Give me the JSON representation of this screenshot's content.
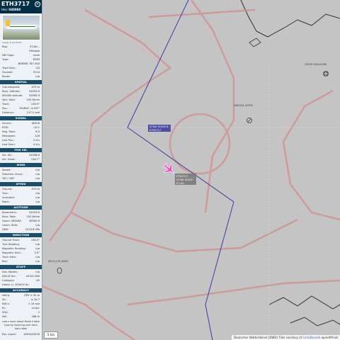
{
  "panel": {
    "callsign": "ETH3717",
    "hex_label": "Hex:",
    "hex": "040088",
    "close_glyph": "×",
    "photo_caption": "image © Jet Photo",
    "basic": [
      {
        "k": "Reg.",
        "v": "ET-AU..."
      },
      {
        "k": "",
        "v": "Ethiopia"
      },
      {
        "k": "DB Flags:",
        "v": "none"
      },
      {
        "k": "Type:",
        "v": "B763"
      },
      {
        "k": "",
        "v": "BOEING 787-300"
      },
      {
        "k": "Type Desc.:",
        "v": "L2J"
      },
      {
        "k": "Squawk:",
        "v": "0114"
      },
      {
        "k": "Route:",
        "v": "n/a"
      }
    ],
    "spatial_title": "SPATIAL",
    "spatial": [
      {
        "k": "Groundspeed:",
        "v": "475 kt"
      },
      {
        "k": "Baro. Altitude:",
        "v": "31025 ft"
      },
      {
        "k": "WGS84 altitude:",
        "v": "32900 ft"
      },
      {
        "k": "Vert. Rate:",
        "v": "192 ft/min"
      },
      {
        "k": "Track:",
        "v": "130.5°"
      },
      {
        "k": "Pos.:",
        "v": "39.694°, 4.947°"
      },
      {
        "k": "Distance:",
        "v": "117.1 nmi"
      }
    ],
    "signal_title": "SIGNAL",
    "signal": [
      {
        "k": "Source:",
        "v": "ADS-B"
      },
      {
        "k": "RSSI:",
        "v": "-10.1"
      },
      {
        "k": "Msg. Rate:",
        "v": "8.0"
      },
      {
        "k": "Messages:",
        "v": "126"
      },
      {
        "k": "Last Pos.:",
        "v": "0.4 s"
      },
      {
        "k": "Last Seen:",
        "v": "0.4 s"
      }
    ],
    "fms_title": "FMS SEL",
    "fms": [
      {
        "k": "Sel. Alt.:",
        "v": "31008 ft"
      },
      {
        "k": "Sel. Head.:",
        "v": "134.7°"
      }
    ],
    "wind_title": "WIND",
    "wind": [
      {
        "k": "Speed:",
        "v": "n/a"
      },
      {
        "k": "Direction (from):",
        "v": "n/a"
      },
      {
        "k": "TAT / OAT:",
        "v": "n/a"
      }
    ],
    "speed_title": "SPEED",
    "speed": [
      {
        "k": "Ground:",
        "v": "475 kt"
      },
      {
        "k": "True:",
        "v": "n/a"
      },
      {
        "k": "Indicated:",
        "v": "n/a"
      },
      {
        "k": "Mach:",
        "v": "n/a"
      }
    ],
    "altitude_title": "ALTITUDE",
    "altitude": [
      {
        "k": "Barometric:",
        "v": "31025 ft"
      },
      {
        "k": "Baro. Rate:",
        "v": "192 ft/min"
      },
      {
        "k": "Geom. WGS84:",
        "v": "32900 ft"
      },
      {
        "k": "Geom. Rate:",
        "v": "n/a"
      },
      {
        "k": "QNH:",
        "v": "1013.8 hPa"
      }
    ],
    "direction_title": "DIRECTION",
    "direction": [
      {
        "k": "Ground Track:",
        "v": "130.5°"
      },
      {
        "k": "True Heading:",
        "v": "n/a"
      },
      {
        "k": "Magnetic Heading:",
        "v": "n/a"
      },
      {
        "k": "Magnetic Decl.:",
        "v": "2.9°"
      },
      {
        "k": "Track Rate:",
        "v": "n/a"
      },
      {
        "k": "Roll:",
        "v": "n/a"
      }
    ],
    "stuff_title": "STUFF",
    "stuff": [
      {
        "k": "Nav. Modes:",
        "v": "n/a"
      },
      {
        "k": "ADS-B Ver.:",
        "v": "v0 DO-260"
      },
      {
        "k": "Category:",
        "v": "A5"
      },
      {
        "k": "Heavy (> 300000 lb)",
        "v": ""
      }
    ],
    "accuracy_title": "ACCURACY",
    "accuracy": [
      {
        "k": "NACp:",
        "v": "EPU < 92 m"
      },
      {
        "k": "SIL:",
        "v": "≤ 1e-7"
      },
      {
        "k": "NACv:",
        "v": "< 10 m/s"
      },
      {
        "k": "Rc:",
        "v": "<n/a>"
      },
      {
        "k": "SDA:",
        "v": "2"
      },
      {
        "k": "NIC:",
        "v": "186 m"
      }
    ],
    "learn_more": "Learn more about Mode S data type by hovering over each data label",
    "pos_epoch_label": "Pos. epoch:",
    "pos_epoch": "1691443233"
  },
  "map": {
    "aircraft_label": [
      "ETH3717",
      "475kt 31025",
      "ET-AU.."
    ],
    "track_label": [
      "475kt 31000 ft",
      "ETH3717"
    ],
    "waypoint_labels": [
      "XERIS MSAGGRE",
      "WBUDA XERIS",
      "BEOLA PLANEE"
    ],
    "colors": {
      "map_bg": "#c4c4c4",
      "airspace": "#d48c8c",
      "track": "#3a3aa0",
      "aircraft": "#f050c8",
      "panel_header": "#002f45"
    },
    "icons": [
      "aircraft-icon",
      "airport-icon",
      "navaid-icon"
    ]
  },
  "attribution": {
    "prefix": "Deutscher Wetterdienst (DWD) Tiles courtesy of ",
    "provider": "CartoBundle",
    "suffix": " openAIP.net"
  },
  "zoom_label": "5 km"
}
